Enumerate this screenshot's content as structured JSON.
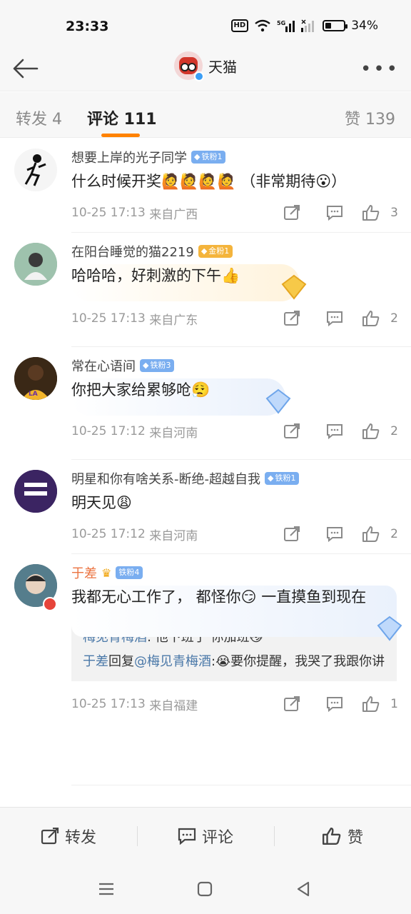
{
  "status": {
    "time": "23:33",
    "battery": "34%",
    "hd": "HD",
    "battery_level": 0.34
  },
  "header": {
    "title": "天猫"
  },
  "tabs": {
    "repost": "转发 4",
    "comment": "评论 111",
    "like": "赞 139"
  },
  "comments": [
    {
      "name": "想要上岸的光子同学",
      "badge": "铁粉1",
      "text": "什么时候开奖🙋🙋🙋🙋 （非常期待😮）",
      "time": "10-25 17:13",
      "location": "来自广西",
      "likes": "3"
    },
    {
      "name": "在阳台睡觉的猫2219",
      "badge": "金粉1",
      "text": "哈哈哈，好刺激的下午👍",
      "time": "10-25 17:13",
      "location": "来自广东",
      "likes": "2"
    },
    {
      "name": "常在心语间",
      "badge": "铁粉3",
      "text": "你把大家给累够呛😮‍💨",
      "time": "10-25 17:12",
      "location": "来自河南",
      "likes": "2"
    },
    {
      "name": "明星和你有啥关系-断绝-超越自我",
      "badge": "铁粉1",
      "text": "明天见😩",
      "time": "10-25 17:12",
      "location": "来自河南",
      "likes": "2"
    },
    {
      "name": "于差",
      "badge": "铁粉4",
      "text": "我都无心工作了， 都怪你😏 一直摸鱼到现在",
      "time": "10-25 17:13",
      "location": "来自福建",
      "likes": "1",
      "reply_1_user": "梅见青梅酒",
      "reply_1_text": ": 他下班了 你加班😼",
      "reply_2_user": "于差",
      "reply_2_mid": "回复",
      "reply_2_at": "@梅见青梅酒",
      "reply_2_text": ":😭要你提醒，我哭了我跟你讲"
    }
  ],
  "bottom_bar": {
    "repost": "转发",
    "comment": "评论",
    "like": "赞"
  }
}
